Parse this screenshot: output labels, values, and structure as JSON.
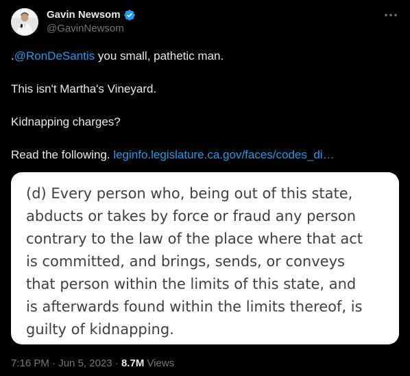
{
  "author": {
    "display_name": "Gavin Newsom",
    "handle": "@GavinNewsom",
    "verified": true,
    "avatar_icon": "avatar-photo"
  },
  "colors": {
    "background": "#000000",
    "text": "#e7e9ea",
    "secondary": "#71767b",
    "link": "#1d9bf0",
    "verified": "#1d9bf0"
  },
  "tweet": {
    "mention_prefix": ".",
    "mention": "@RonDeSantis",
    "line1_rest": " you small, pathetic man.",
    "line2": "This isn't Martha's Vineyard.",
    "line3": "Kidnapping charges?",
    "line4_text": "Read the following. ",
    "line4_link": "leginfo.legislature.ca.gov/faces/codes_di…"
  },
  "media": {
    "lines": [
      "(d) Every person who, being out of this state,",
      "abducts or takes by force or fraud any person",
      "contrary to the law of the place where that act",
      "is committed, and brings, sends, or conveys",
      "that person within the limits of this state, and",
      "is afterwards found within the limits thereof, is",
      "guilty of kidnapping."
    ]
  },
  "meta": {
    "time": "7:16 PM",
    "separator": " · ",
    "date": "Jun 5, 2023",
    "separator2": " · ",
    "views_count": "8.7M",
    "views_label": " Views"
  }
}
